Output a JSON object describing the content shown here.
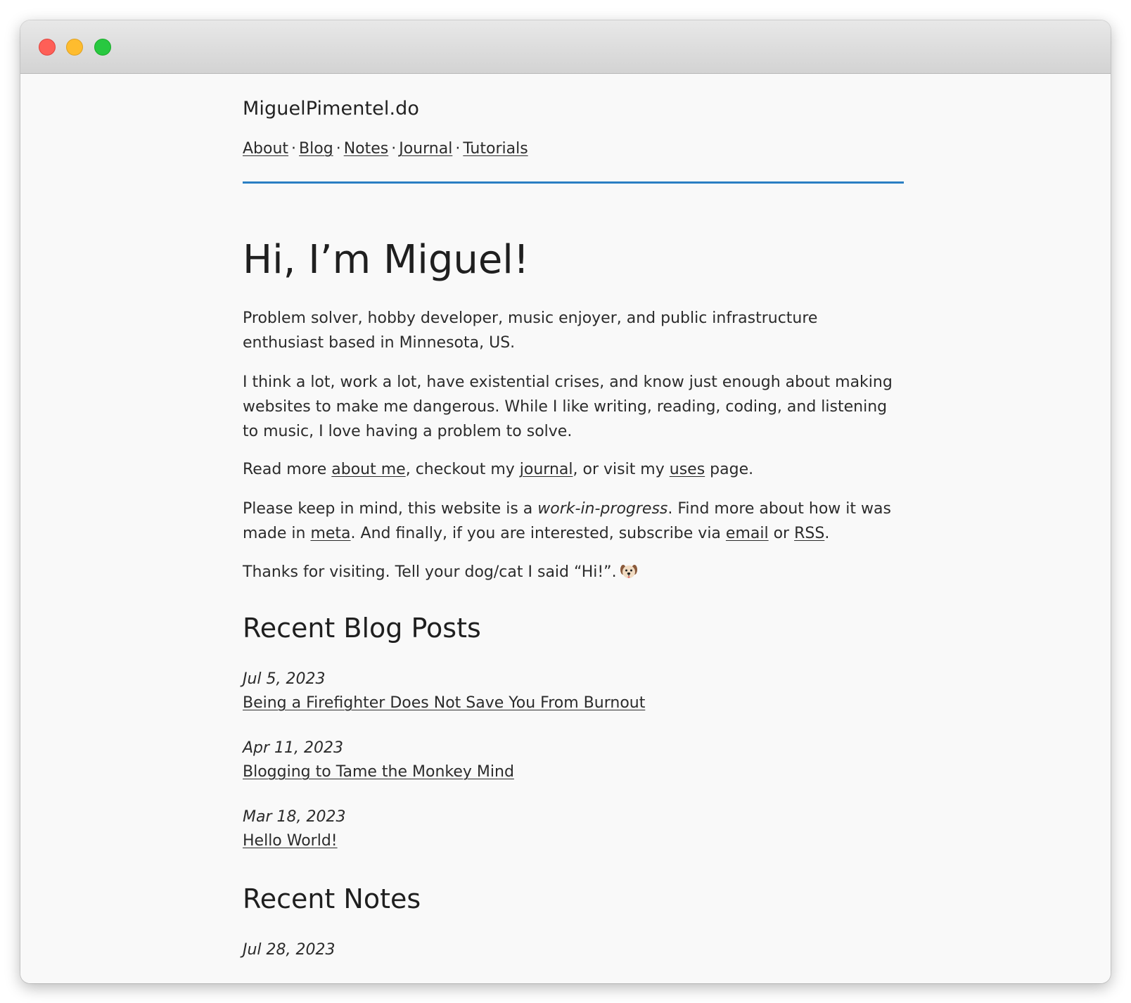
{
  "site": {
    "title": "MiguelPimentel.do"
  },
  "nav": {
    "items": [
      {
        "label": "About"
      },
      {
        "label": "Blog"
      },
      {
        "label": "Notes"
      },
      {
        "label": "Journal"
      },
      {
        "label": "Tutorials"
      }
    ],
    "separator": "·"
  },
  "accent_color": "#2b7fc3",
  "hero": {
    "heading": "Hi, I’m Miguel!"
  },
  "intro": {
    "p1": "Problem solver, hobby developer, music enjoyer, and public infrastructure enthusiast based in Minnesota, US.",
    "p2": "I think a lot, work a lot, have existential crises, and know just enough about making websites to make me dangerous. While I like writing, reading, coding, and listening to music, I love having a problem to solve.",
    "p3": {
      "t1": "Read more ",
      "link_about": "about me",
      "t2": ", checkout my ",
      "link_journal": "journal",
      "t3": ", or visit my ",
      "link_uses": "uses",
      "t4": " page."
    },
    "p4": {
      "t1": "Please keep in mind, this website is a ",
      "em": "work-in-progress",
      "t2": ". Find more about how it was made in ",
      "link_meta": "meta",
      "t3": ". And finally, if you are interested, subscribe via ",
      "link_email": "email",
      "t4": " or ",
      "link_rss": "RSS",
      "t5": "."
    },
    "p5": {
      "text": "Thanks for visiting. Tell your dog/cat I said “Hi!”.",
      "icon": "dog-face-icon"
    }
  },
  "recent_posts": {
    "heading": "Recent Blog Posts",
    "items": [
      {
        "date": "Jul 5, 2023",
        "title": "Being a Firefighter Does Not Save You From Burnout"
      },
      {
        "date": "Apr 11, 2023",
        "title": "Blogging to Tame the Monkey Mind"
      },
      {
        "date": "Mar 18, 2023",
        "title": "Hello World!"
      }
    ]
  },
  "recent_notes": {
    "heading": "Recent Notes",
    "items": [
      {
        "date": "Jul 28, 2023"
      }
    ]
  }
}
